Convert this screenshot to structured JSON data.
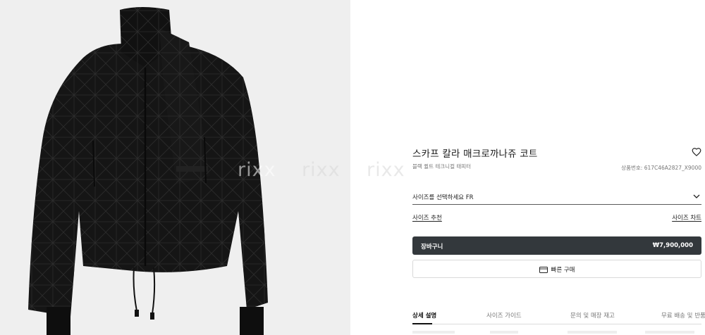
{
  "product": {
    "title": "스카프 칼라 매크로까나쥬 코트",
    "subtitle": "블랙 퀼트 테크니컬 태피터",
    "code": "상품번호: 617C46A2827_X9000",
    "image_alt": "black quilted cannage jacket with scarf collar"
  },
  "size_selector": {
    "label": "사이즈를 선택하세요 FR"
  },
  "links": {
    "recommend": "사이즈 추천",
    "chart": "사이즈 차트"
  },
  "cart_button": {
    "label": "장바구니",
    "price": "₩7,900,000"
  },
  "quick_buy": {
    "label": "빠른 구매"
  },
  "tabs": [
    {
      "label": "상세 설명",
      "active": true
    },
    {
      "label": "사이즈 가이드",
      "active": false
    },
    {
      "label": "문의 및 매장 재고",
      "active": false
    },
    {
      "label": "무료 배송 및 반품",
      "active": false
    }
  ],
  "watermark": {
    "text": "rixx"
  },
  "colors": {
    "image_bg": "#efefef",
    "jacket": "#151515",
    "cart_bg": "#33383c",
    "text": "#222222",
    "muted": "#777777"
  },
  "icons": {
    "wishlist": "heart-icon",
    "size_dropdown": "chevron-down-icon",
    "quick_buy": "card-icon"
  }
}
